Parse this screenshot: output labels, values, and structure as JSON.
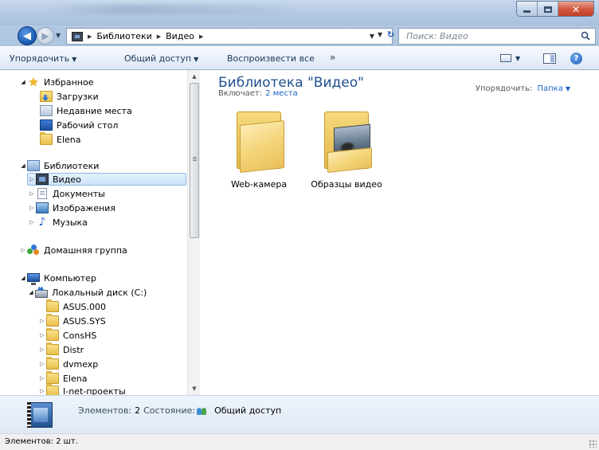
{
  "address": {
    "crumbs": [
      "Библиотеки",
      "Видео"
    ],
    "search_placeholder": "Поиск: Видео"
  },
  "toolbar": {
    "organize": "Упорядочить",
    "share": "Общий доступ",
    "play_all": "Воспроизвести все",
    "more": "»"
  },
  "nav": {
    "favorites": {
      "label": "Избранное",
      "items": [
        "Загрузки",
        "Недавние места",
        "Рабочий стол",
        "Elena"
      ]
    },
    "libraries": {
      "label": "Библиотеки",
      "items": [
        "Видео",
        "Документы",
        "Изображения",
        "Музыка"
      ],
      "selected": "Видео"
    },
    "homegroup": "Домашняя группа",
    "computer": {
      "label": "Компьютер",
      "drive": "Локальный диск (C:)",
      "folders": [
        "ASUS.000",
        "ASUS.SYS",
        "ConsHS",
        "Distr",
        "dvmexp",
        "Elena",
        "I-net-проекты"
      ]
    }
  },
  "main": {
    "title": "Библиотека \"Видео\"",
    "includes_label": "Включает:",
    "includes_link": "2 места",
    "arrange_label": "Упорядочить:",
    "arrange_value": "Папка",
    "items": [
      {
        "name": "Web-камера",
        "kind": "folder"
      },
      {
        "name": "Образцы видео",
        "kind": "folder-with-thumbnail"
      }
    ]
  },
  "details": {
    "elements_label": "Элементов:",
    "elements_value": "2",
    "state_label": "Состояние:",
    "state_value": "Общий доступ"
  },
  "status": {
    "text": "Элементов: 2 шт."
  },
  "colors": {
    "accent": "#1e64c8",
    "title": "#1e4f8f",
    "selection": "#cce4fb"
  }
}
